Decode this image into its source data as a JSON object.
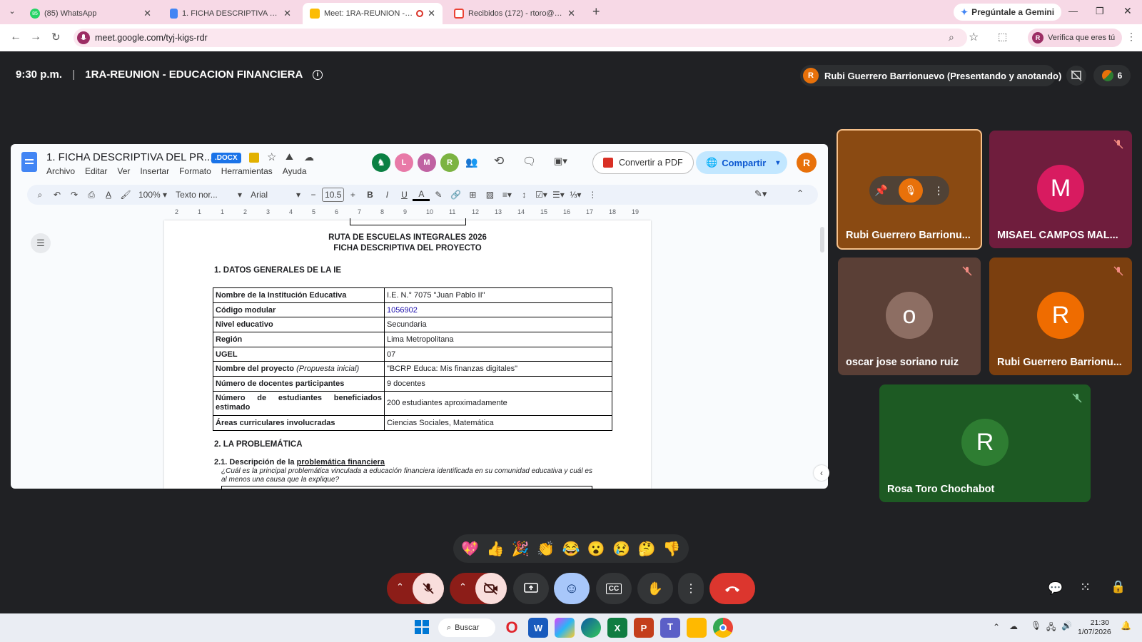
{
  "browser": {
    "tabs": [
      {
        "title": "(85) WhatsApp",
        "badge": "85",
        "color": "#25d366"
      },
      {
        "title": "1. FICHA DESCRIPTIVA DEL PRC",
        "color": "#4285f4"
      },
      {
        "title": "Meet: 1RA-REUNION - EDU",
        "color": "#fbbc04"
      },
      {
        "title": "Recibidos (172) - rtoro@ie7075",
        "color": "#ea4335"
      }
    ],
    "new_tab": "+",
    "gemini_button": "Pregúntale a Gemini",
    "url": "meet.google.com/tyj-kigs-rdr",
    "verify_label": "Verifica que eres tú"
  },
  "meet": {
    "time": "9:30 p.m.",
    "separator": "|",
    "meeting_title": "1RA-REUNION - EDUCACION FINANCIERA",
    "presenter_text": "Rubi Guerrero Barrionuevo (Presentando y anotando)",
    "presenter_initial": "R",
    "participant_count": "6"
  },
  "docs": {
    "title": "1. FICHA DESCRIPTIVA DEL PR...",
    "badge": ".DOCX",
    "menus": [
      "Archivo",
      "Editar",
      "Ver",
      "Insertar",
      "Formato",
      "Herramientas",
      "Ayuda"
    ],
    "collaborators": [
      "L",
      "M",
      "R"
    ],
    "convert_button": "Convertir a PDF",
    "share_button": "Compartir",
    "user_initial": "R",
    "toolbar": {
      "zoom": "100%",
      "style": "Texto nor...",
      "font": "Arial",
      "font_size": "10.5"
    },
    "ruler_ticks": [
      "2",
      "1",
      "1",
      "2",
      "3",
      "4",
      "5",
      "6",
      "7",
      "8",
      "9",
      "10",
      "11",
      "12",
      "13",
      "14",
      "15",
      "16",
      "17",
      "18",
      "19"
    ],
    "heading1": "RUTA DE ESCUELAS INTEGRALES 2026",
    "heading2": "FICHA DESCRIPTIVA DEL PROYECTO",
    "section1": "1. DATOS GENERALES DE LA IE",
    "table": [
      {
        "k": "Nombre de la Institución Educativa",
        "v": "I.E. N.° 7075 \"Juan Pablo II\""
      },
      {
        "k": "Código modular",
        "v": "1056902"
      },
      {
        "k": "Nivel educativo",
        "v": "Secundaria"
      },
      {
        "k": "Región",
        "v": "Lima Metropolitana"
      },
      {
        "k": "UGEL",
        "v": "07"
      },
      {
        "k": "Nombre del proyecto",
        "k_note": "(Propuesta inicial)",
        "v": "\"BCRP Educa: Mis finanzas digitales\""
      },
      {
        "k": "Número de docentes participantes",
        "v": "9 docentes"
      },
      {
        "k": "Número de estudiantes beneficiados estimado",
        "v": "200 estudiantes aproximadamente"
      },
      {
        "k": "Áreas curriculares involucradas",
        "v": "Ciencias Sociales, Matemática"
      }
    ],
    "section2": "2. LA PROBLEMÁTICA",
    "sub21_prefix": "2.1. Descripción de la",
    "sub21_link": "problemática financiera",
    "question": "¿Cuál es la principal problemática vinculada a educación financiera identificada en su comunidad educativa y cuál es al menos una causa que la explique?"
  },
  "participants": [
    {
      "name": "Rubi Guerrero Barrionu...",
      "initial": "R",
      "color": "#e8710a",
      "bg": "#8a4a12",
      "speaking": true
    },
    {
      "name": "MISAEL CAMPOS MAL...",
      "initial": "M",
      "color": "#d81b60",
      "bg": "#6f1d3d",
      "muted": true
    },
    {
      "name": "oscar jose soriano ruiz",
      "initial": "o",
      "color": "#8d6e63",
      "bg": "#5a3f36",
      "muted": true
    },
    {
      "name": "Rubi Guerrero Barrionu...",
      "initial": "R",
      "color": "#ef6c00",
      "bg": "#7b3f0f",
      "muted": true
    },
    {
      "name": "Rosa Toro Chochabot",
      "initial": "R",
      "color": "#2e7d32",
      "bg": "#1d5a23",
      "muted": true
    }
  ],
  "reactions": [
    "💖",
    "👍",
    "🎉",
    "👏",
    "😂",
    "😮",
    "😢",
    "🤔",
    "👎"
  ],
  "taskbar": {
    "search": "Buscar",
    "time": "21:30",
    "date": "1/07/2026"
  }
}
